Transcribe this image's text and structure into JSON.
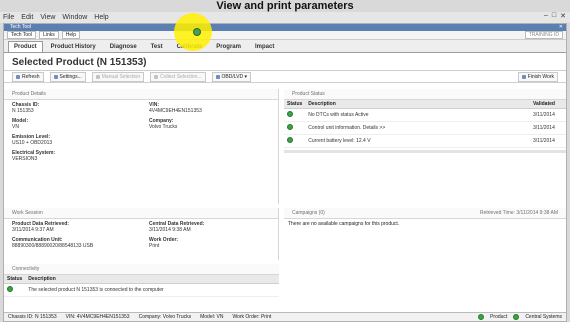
{
  "overlay_title": "View and print parameters",
  "os_menu": [
    "File",
    "Edit",
    "View",
    "Window",
    "Help"
  ],
  "app": {
    "window_title": "Tech Tool",
    "menus": [
      "Tech Tool",
      "Links",
      "Help"
    ],
    "training_id": "TRAINING ID"
  },
  "tabs": [
    "Product",
    "Product History",
    "Diagnose",
    "Test",
    "Calibrate",
    "Program",
    "Impact"
  ],
  "selected_product": "Selected Product (N 151353)",
  "toolbar": {
    "refresh": "Refresh",
    "settings": "Settings...",
    "manual_selection": "Manual Selection",
    "collect_selection": "Collect Selection...",
    "obd": "OBD/LVD ▾",
    "finish": "Finish Work"
  },
  "product_details": {
    "title": "Product Details",
    "chassis_label": "Chassis ID:",
    "chassis_val": "N 151353",
    "vin_label": "VIN:",
    "vin_val": "4V4MC9EH4EN151353",
    "model_label": "Model:",
    "model_val": "VN",
    "company_label": "Company:",
    "company_val": "Volvo Trucks",
    "emission_label": "Emission Level:",
    "emission_val": "US10 + OBD2013",
    "electrical_label": "Electrical System:",
    "electrical_val": "VERSION3"
  },
  "product_status": {
    "title": "Product Status",
    "col_status": "Status",
    "col_desc": "Description",
    "col_validated": "Validated",
    "rows": [
      {
        "desc": "No DTCs with status Active",
        "validated": "3/11/2014"
      },
      {
        "desc": "Control unit information. Details >>",
        "validated": "3/11/2014"
      },
      {
        "desc": "Current battery level: 12.4 V",
        "validated": "3/11/2014"
      }
    ]
  },
  "work_session": {
    "title": "Work Session",
    "pdr_label": "Product Data Retrieved:",
    "pdr_val": "3/11/2014 9:37 AM",
    "cdr_label": "Central Data Retrieved:",
    "cdr_val": "3/11/2014 9:38 AM",
    "comm_label": "Communication Unit:",
    "comm_val": "88890300/88890020/88548133 USB",
    "wo_label": "Work Order:",
    "wo_val": "Print"
  },
  "campaigns": {
    "title": "Campaigns (0)",
    "retrieved": "Retrieved Time: 3/11/2014 9:38 AM",
    "message": "There are no available campaigns for this product."
  },
  "connectivity": {
    "title": "Connectivity",
    "col_status": "Status",
    "col_desc": "Description",
    "row": "The selected product N 151353 is connected to the computer"
  },
  "status_bar": {
    "chassis": "Chassis ID: N 151353",
    "vin": "VIN: 4V4MC9EH4EN151353",
    "company": "Company: Volvo Trucks",
    "model": "Model: VN",
    "wo": "Work Order: Print",
    "product": "Product",
    "central": "Central Systems"
  }
}
